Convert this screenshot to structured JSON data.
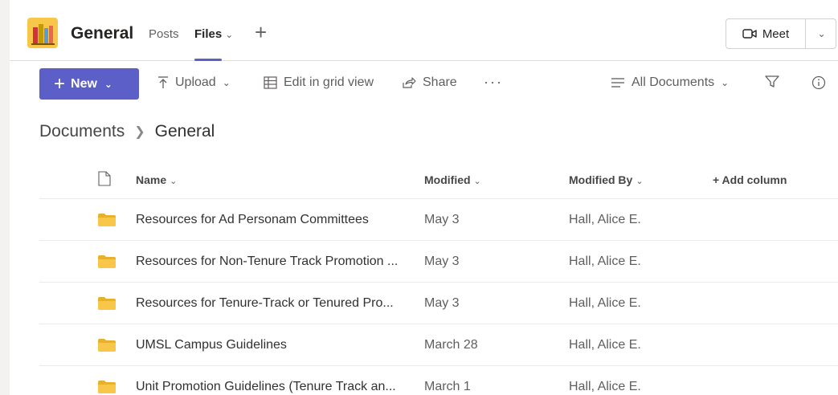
{
  "header": {
    "channel_name": "General",
    "tabs": [
      {
        "label": "Posts"
      },
      {
        "label": "Files"
      }
    ],
    "meet_label": "Meet"
  },
  "commands": {
    "new_label": "New",
    "upload_label": "Upload",
    "grid_label": "Edit in grid view",
    "share_label": "Share",
    "more_label": "···",
    "view_label": "All Documents"
  },
  "breadcrumb": {
    "root": "Documents",
    "current": "General"
  },
  "table": {
    "columns": {
      "name": "Name",
      "modified": "Modified",
      "modified_by": "Modified By",
      "add_column": "+ Add column"
    },
    "rows": [
      {
        "name": "Resources for Ad Personam Committees",
        "modified": "May 3",
        "modified_by": "Hall, Alice E."
      },
      {
        "name": "Resources for Non-Tenure Track Promotion ...",
        "modified": "May 3",
        "modified_by": "Hall, Alice E."
      },
      {
        "name": "Resources for Tenure-Track or Tenured Pro...",
        "modified": "May 3",
        "modified_by": "Hall, Alice E."
      },
      {
        "name": "UMSL Campus Guidelines",
        "modified": "March 28",
        "modified_by": "Hall, Alice E."
      },
      {
        "name": "Unit Promotion Guidelines (Tenure Track an...",
        "modified": "March 1",
        "modified_by": "Hall, Alice E."
      }
    ]
  },
  "colors": {
    "accent": "#5b5fc7",
    "folder": "#f8c749",
    "team_avatar_bg": "#f8c749"
  }
}
